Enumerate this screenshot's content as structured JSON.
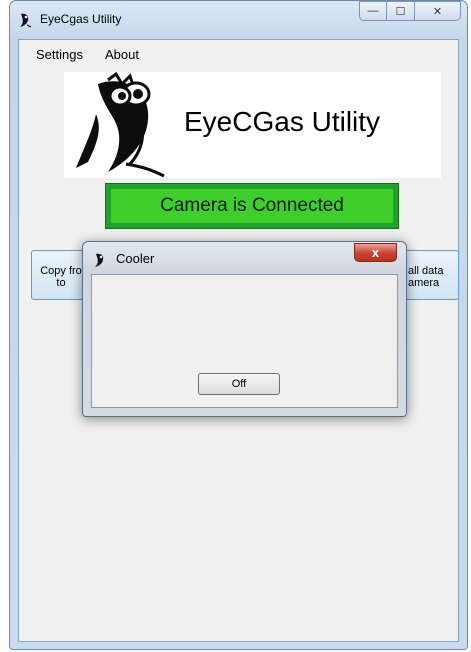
{
  "window": {
    "title": "EyeCgas Utility",
    "icon": "owl-icon",
    "controls": {
      "minimize": "—",
      "maximize": "☐",
      "close": "✕"
    }
  },
  "menu": {
    "items": [
      "Settings",
      "About"
    ]
  },
  "banner": {
    "logo": "owl-logo",
    "title": "EyeCGas Utility"
  },
  "status": {
    "text": "Camera is Connected",
    "color": "#3fcf2c"
  },
  "buttons": {
    "left": {
      "line1": "Copy fro",
      "line2": "to"
    },
    "right": {
      "line1": "all data",
      "line2": "amera"
    }
  },
  "dialog": {
    "title": "Cooler",
    "icon": "owl-icon",
    "close_label": "x",
    "button_label": "Off"
  }
}
